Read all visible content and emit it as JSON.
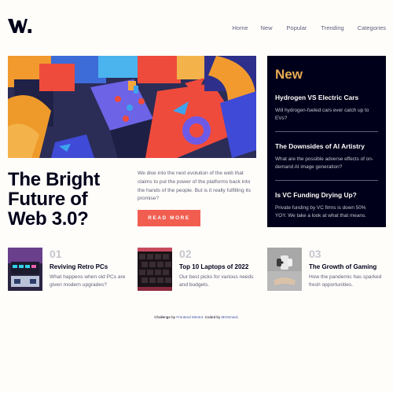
{
  "header": {
    "logo_text": "W.",
    "nav": [
      "Home",
      "New",
      "Popular",
      "Trending",
      "Categories"
    ]
  },
  "hero": {
    "image": "3d-abstract-blocks-image",
    "headline": "The Bright Future of Web 3.0?",
    "description": "We dive into the next evolution of the web that claims to put the power of the platforms back into the hands of the people. But is it really fulfilling its promise?",
    "button_label": "READ MORE"
  },
  "new": {
    "title": "New",
    "items": [
      {
        "title": "Hydrogen VS Electric Cars",
        "desc": "Will hydrogen-fueled cars ever catch up to EVs?"
      },
      {
        "title": "The Downsides of AI Artistry",
        "desc": "What are the possible adverse effects of on-demand AI image generation?"
      },
      {
        "title": "Is VC Funding Drying Up?",
        "desc": "Private funding by VC firms is down 50% YOY. We take a look at what that means."
      }
    ]
  },
  "cards": [
    {
      "num": "01",
      "title": "Reviving Retro PCs",
      "desc": "What happens when old PCs are given modern upgrades?",
      "image": "retro-pc-image"
    },
    {
      "num": "02",
      "title": "Top 10 Laptops of 2022",
      "desc": "Our best picks for various needs and budgets.",
      "image": "laptop-keyboard-image"
    },
    {
      "num": "03",
      "title": "The Growth of Gaming",
      "desc": "How the pandemic has sparked fresh opportunities.",
      "image": "gaming-controller-image"
    }
  ],
  "footer": {
    "prefix": "Challenge by ",
    "link1": "Frontend Mentor",
    "middle": ". Coded by ",
    "link2": "MOSmard",
    "suffix": "."
  },
  "colors": {
    "accent": "#f15e50",
    "panel": "#00001a",
    "new_title": "#e9ab53",
    "text_dark": "#00001a",
    "text_muted": "#5d5f79",
    "number_grey": "#c5c6ce",
    "background": "#fffdfa"
  }
}
